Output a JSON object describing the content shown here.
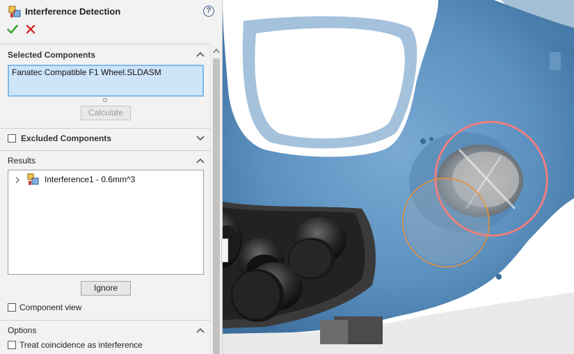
{
  "header": {
    "title": "Interference Detection",
    "help_symbol": "?",
    "icons": {
      "feature": "interference-detection-icon",
      "ok": "checkmark-icon",
      "cancel": "close-icon",
      "help": "help-icon"
    }
  },
  "selected_components": {
    "title": "Selected Components",
    "items": [
      "Fanatec Compatible F1 Wheel.SLDASM"
    ],
    "calculate_label": "Calculate",
    "calculate_enabled": false
  },
  "excluded_components": {
    "title": "Excluded Components",
    "checked": false
  },
  "results": {
    "title": "Results",
    "items": [
      {
        "label": "Interference1 - 0.6mm^3",
        "icon": "interference-icon"
      }
    ],
    "ignore_label": "Ignore",
    "component_view_label": "Component view",
    "component_view_checked": false
  },
  "options": {
    "title": "Options",
    "treat_coincidence_label": "Treat coincidence as interference",
    "treat_coincidence_checked": false
  },
  "colors": {
    "model_blue": "#5b90bf",
    "interference_ring_red": "#f07e7e",
    "interference_ring_orange": "#e8913a",
    "ok_green": "#3aa635",
    "cancel_red": "#d22a2a",
    "selection_fill": "#cde4f9"
  }
}
